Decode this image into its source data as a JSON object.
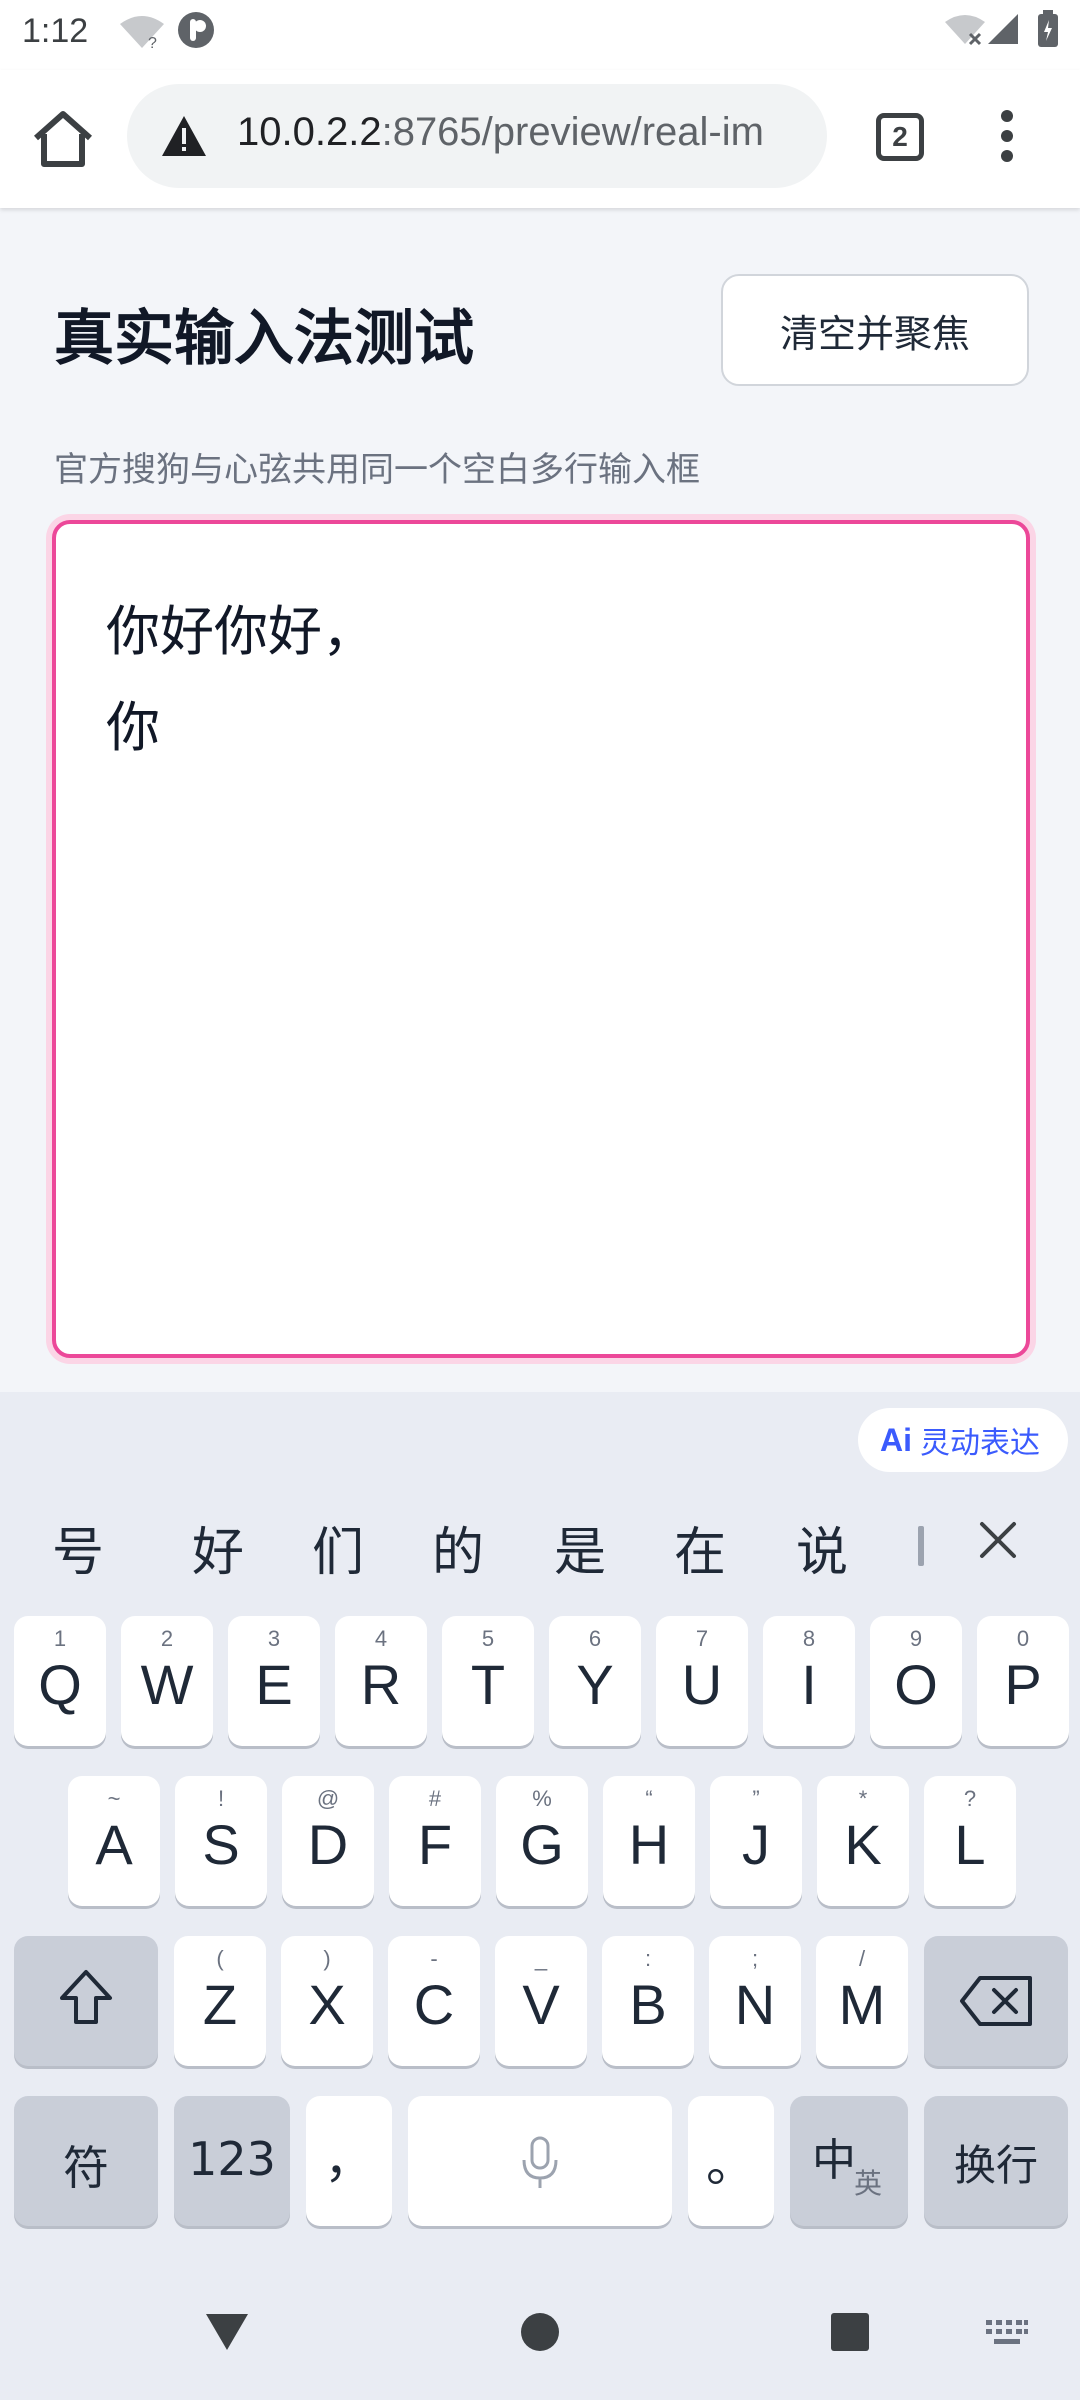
{
  "status_bar": {
    "time": "1:12"
  },
  "browser": {
    "url_host": "10.0.2.2",
    "url_path": ":8765/preview/real-im",
    "tab_count": "2"
  },
  "page": {
    "title": "真实输入法测试",
    "clear_button": "清空并聚焦",
    "subtitle": "官方搜狗与心弦共用同一个空白多行输入框",
    "textarea_text": "你好你好，\n你"
  },
  "keyboard": {
    "ai_chip_icon": "Ai",
    "ai_chip_label": "灵动表达",
    "candidates": [
      "号",
      "好",
      "们",
      "的",
      "是",
      "在",
      "说"
    ],
    "row1": [
      {
        "main": "Q",
        "sub": "1"
      },
      {
        "main": "W",
        "sub": "2"
      },
      {
        "main": "E",
        "sub": "3"
      },
      {
        "main": "R",
        "sub": "4"
      },
      {
        "main": "T",
        "sub": "5"
      },
      {
        "main": "Y",
        "sub": "6"
      },
      {
        "main": "U",
        "sub": "7"
      },
      {
        "main": "I",
        "sub": "8"
      },
      {
        "main": "O",
        "sub": "9"
      },
      {
        "main": "P",
        "sub": "0"
      }
    ],
    "row2": [
      {
        "main": "A",
        "sub": "~"
      },
      {
        "main": "S",
        "sub": "!"
      },
      {
        "main": "D",
        "sub": "@"
      },
      {
        "main": "F",
        "sub": "#"
      },
      {
        "main": "G",
        "sub": "%"
      },
      {
        "main": "H",
        "sub": "“"
      },
      {
        "main": "J",
        "sub": "”"
      },
      {
        "main": "K",
        "sub": "*"
      },
      {
        "main": "L",
        "sub": "?"
      }
    ],
    "row3": [
      {
        "main": "Z",
        "sub": "("
      },
      {
        "main": "X",
        "sub": ")"
      },
      {
        "main": "C",
        "sub": "-"
      },
      {
        "main": "V",
        "sub": "_"
      },
      {
        "main": "B",
        "sub": ":"
      },
      {
        "main": "N",
        "sub": ";"
      },
      {
        "main": "M",
        "sub": "/"
      }
    ],
    "symbols_label": "符",
    "numbers_label": "123",
    "comma_label": "，",
    "period_label": "。",
    "lang_primary": "中",
    "lang_secondary": "英",
    "enter_label": "换行"
  },
  "colors": {
    "accent_pink": "#ec4899",
    "ai_blue": "#3b5bfd"
  }
}
